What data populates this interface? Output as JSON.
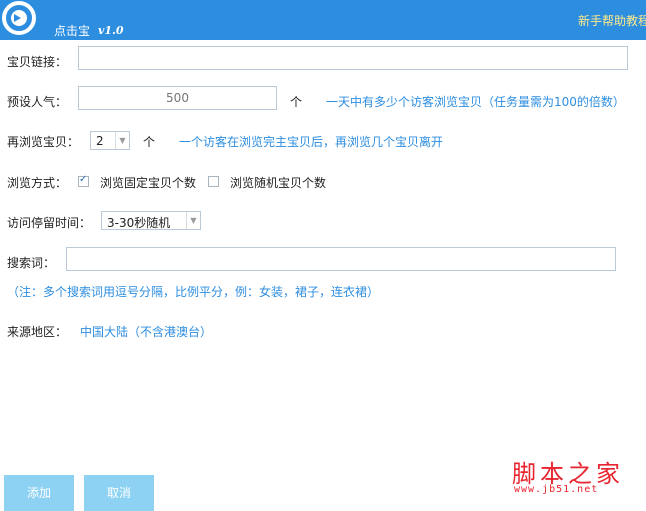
{
  "app": {
    "name": "点击宝",
    "version": "v1.0",
    "help_link": "新手帮助教程"
  },
  "form": {
    "item_link": {
      "label": "宝贝链接：",
      "value": ""
    },
    "popularity": {
      "label": "预设人气：",
      "placeholder": "500",
      "unit": "个",
      "hint": "一天中有多少个访客浏览宝贝（任务量需为100的倍数）"
    },
    "rebrowse": {
      "label": "再浏览宝贝：",
      "value": "2",
      "unit": "个",
      "hint": "一个访客在浏览完主宝贝后，再浏览几个宝贝离开"
    },
    "browse_mode": {
      "label": "浏览方式：",
      "options": [
        {
          "label": "浏览固定宝贝个数",
          "checked": true
        },
        {
          "label": "浏览随机宝贝个数",
          "checked": false
        }
      ]
    },
    "stay_time": {
      "label": "访问停留时间：",
      "value": "3-30秒随机"
    },
    "keywords": {
      "label": "搜索词：",
      "value": "",
      "note": "（注：多个搜索词用逗号分隔，比例平分，例：女装，裙子，连衣裙）"
    },
    "source_region": {
      "label": "来源地区：",
      "value": "中国大陆（不含港澳台）"
    }
  },
  "buttons": {
    "add": "添加",
    "cancel": "取消"
  },
  "watermark": {
    "text": "脚本之家",
    "url": "www.jb51.net"
  },
  "colors": {
    "titlebar": "#2d8ee0",
    "hint": "#2d8ee0",
    "button": "#8dd2f2",
    "watermark": "#e8252f",
    "help_link": "#ffe98a"
  }
}
